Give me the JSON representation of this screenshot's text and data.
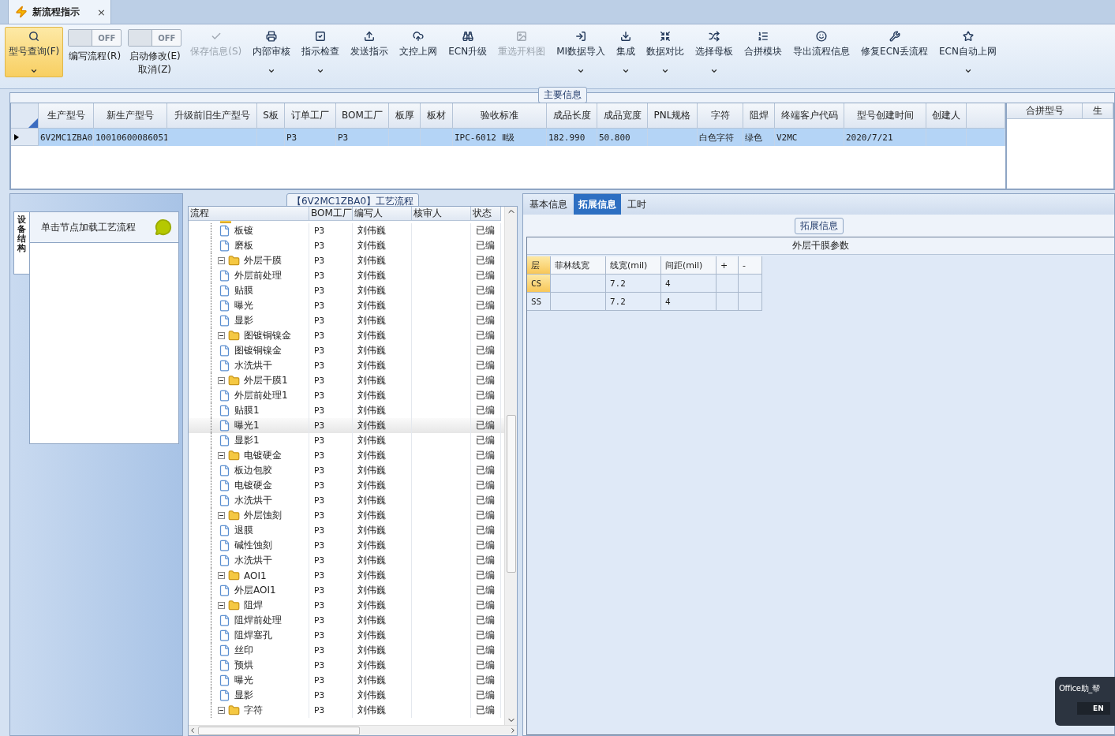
{
  "doc_tab": {
    "title": "新流程指示",
    "close": "×"
  },
  "ribbon": [
    {
      "kind": "button",
      "label": "型号查询(F)",
      "selected": true,
      "disabled": false,
      "dropdown": true
    },
    {
      "kind": "toggle",
      "label": "编写流程(R)",
      "switch": "OFF",
      "on": false
    },
    {
      "kind": "toggle",
      "label": "启动修改(E)",
      "sublabel": "取消(Z)",
      "switch": "OFF",
      "on": false
    },
    {
      "kind": "button",
      "label": "保存信息(S)",
      "selected": false,
      "disabled": true,
      "dropdown": false
    },
    {
      "kind": "button",
      "label": "内部审核",
      "selected": false,
      "disabled": false,
      "dropdown": true
    },
    {
      "kind": "button",
      "label": "指示检查",
      "selected": false,
      "disabled": false,
      "dropdown": true
    },
    {
      "kind": "button",
      "label": "发送指示",
      "selected": false,
      "disabled": false,
      "dropdown": false
    },
    {
      "kind": "button",
      "label": "文控上网",
      "selected": false,
      "disabled": false,
      "dropdown": false
    },
    {
      "kind": "button",
      "label": "ECN升级",
      "selected": false,
      "disabled": false,
      "dropdown": false
    },
    {
      "kind": "button",
      "label": "重选开料图",
      "selected": false,
      "disabled": true,
      "dropdown": false
    },
    {
      "kind": "button",
      "label": "MI数据导入",
      "selected": false,
      "disabled": false,
      "dropdown": true
    },
    {
      "kind": "button",
      "label": "集成",
      "selected": false,
      "disabled": false,
      "dropdown": true
    },
    {
      "kind": "button",
      "label": "数据对比",
      "selected": false,
      "disabled": false,
      "dropdown": true
    },
    {
      "kind": "button",
      "label": "选择母板",
      "selected": false,
      "disabled": false,
      "dropdown": true
    },
    {
      "kind": "button",
      "label": "合拼模块",
      "selected": false,
      "disabled": false,
      "dropdown": false
    },
    {
      "kind": "button",
      "label": "导出流程信息",
      "selected": false,
      "disabled": false,
      "dropdown": false
    },
    {
      "kind": "button",
      "label": "修复ECN丢流程",
      "selected": false,
      "disabled": false,
      "dropdown": false
    },
    {
      "kind": "button",
      "label": "ECN自动上网",
      "selected": false,
      "disabled": false,
      "dropdown": true
    }
  ],
  "main_info": {
    "title": "主要信息",
    "columns": [
      "生产型号",
      "新生产型号",
      "升级前旧生产型号",
      "S板",
      "订单工厂",
      "BOM工厂",
      "板厚",
      "板材",
      "验收标准",
      "成品长度",
      "成品宽度",
      "PNL规格",
      "字符",
      "阻焊",
      "终端客户代码",
      "型号创建时间",
      "创建人"
    ],
    "rows": [
      {
        "selected": true,
        "cells": [
          "6V2MC1ZBA0",
          "10010600086051",
          null,
          null,
          "P3",
          "P3",
          null,
          null,
          "IPC-6012 Ⅱ级",
          "182.990",
          "50.800",
          null,
          "白色字符",
          "绿色",
          "V2MC",
          "2020/7/21",
          null
        ]
      }
    ],
    "side_columns": [
      "合拼型号",
      "生"
    ]
  },
  "left_panel": {
    "vertical_tab": "设备结构",
    "hint": "单击节点加载工艺流程"
  },
  "process": {
    "title": "【6V2MC1ZBA0】工艺流程",
    "columns": [
      "流程",
      "BOM工厂",
      "编写人",
      "核审人",
      "状态"
    ],
    "tree": [
      {
        "kind": "folder",
        "children": [
          {
            "kind": "step",
            "label": "板镀",
            "bom": "P3",
            "writer": "刘伟巍",
            "status": "已编",
            "selected": false
          },
          {
            "kind": "step",
            "label": "磨板",
            "bom": "P3",
            "writer": "刘伟巍",
            "status": "已编",
            "selected": false
          }
        ]
      },
      {
        "kind": "folder",
        "label": "外层干膜",
        "bom": "P3",
        "writer": "刘伟巍",
        "status": "已编",
        "selected": false,
        "expanded": true,
        "children": [
          {
            "kind": "step",
            "label": "外层前处理",
            "bom": "P3",
            "writer": "刘伟巍",
            "status": "已编",
            "selected": false
          },
          {
            "kind": "step",
            "label": "贴膜",
            "bom": "P3",
            "writer": "刘伟巍",
            "status": "已编",
            "selected": false
          },
          {
            "kind": "step",
            "label": "曝光",
            "bom": "P3",
            "writer": "刘伟巍",
            "status": "已编",
            "selected": false
          },
          {
            "kind": "step",
            "label": "显影",
            "bom": "P3",
            "writer": "刘伟巍",
            "status": "已编",
            "selected": false
          }
        ]
      },
      {
        "kind": "folder",
        "label": "图镀铜镍金",
        "bom": "P3",
        "writer": "刘伟巍",
        "status": "已编",
        "selected": false,
        "expanded": true,
        "children": [
          {
            "kind": "step",
            "label": "图镀铜镍金",
            "bom": "P3",
            "writer": "刘伟巍",
            "status": "已编",
            "selected": false
          },
          {
            "kind": "step",
            "label": "水洗烘干",
            "bom": "P3",
            "writer": "刘伟巍",
            "status": "已编",
            "selected": false
          }
        ]
      },
      {
        "kind": "folder",
        "label": "外层干膜1",
        "bom": "P3",
        "writer": "刘伟巍",
        "status": "已编",
        "selected": false,
        "expanded": true,
        "children": [
          {
            "kind": "step",
            "label": "外层前处理1",
            "bom": "P3",
            "writer": "刘伟巍",
            "status": "已编",
            "selected": false
          },
          {
            "kind": "step",
            "label": "贴膜1",
            "bom": "P3",
            "writer": "刘伟巍",
            "status": "已编",
            "selected": false
          },
          {
            "kind": "step",
            "label": "曝光1",
            "bom": "P3",
            "writer": "刘伟巍",
            "status": "已编",
            "selected": true
          },
          {
            "kind": "step",
            "label": "显影1",
            "bom": "P3",
            "writer": "刘伟巍",
            "status": "已编",
            "selected": false
          }
        ]
      },
      {
        "kind": "folder",
        "label": "电镀硬金",
        "bom": "P3",
        "writer": "刘伟巍",
        "status": "已编",
        "selected": false,
        "expanded": true,
        "children": [
          {
            "kind": "step",
            "label": "板边包胶",
            "bom": "P3",
            "writer": "刘伟巍",
            "status": "已编",
            "selected": false
          },
          {
            "kind": "step",
            "label": "电镀硬金",
            "bom": "P3",
            "writer": "刘伟巍",
            "status": "已编",
            "selected": false
          },
          {
            "kind": "step",
            "label": "水洗烘干",
            "bom": "P3",
            "writer": "刘伟巍",
            "status": "已编",
            "selected": false
          }
        ]
      },
      {
        "kind": "folder",
        "label": "外层蚀刻",
        "bom": "P3",
        "writer": "刘伟巍",
        "status": "已编",
        "selected": false,
        "expanded": true,
        "children": [
          {
            "kind": "step",
            "label": "退膜",
            "bom": "P3",
            "writer": "刘伟巍",
            "status": "已编",
            "selected": false
          },
          {
            "kind": "step",
            "label": "碱性蚀刻",
            "bom": "P3",
            "writer": "刘伟巍",
            "status": "已编",
            "selected": false
          },
          {
            "kind": "step",
            "label": "水洗烘干",
            "bom": "P3",
            "writer": "刘伟巍",
            "status": "已编",
            "selected": false
          }
        ]
      },
      {
        "kind": "folder",
        "label": "AOI1",
        "bom": "P3",
        "writer": "刘伟巍",
        "status": "已编",
        "selected": false,
        "expanded": true,
        "children": [
          {
            "kind": "step",
            "label": "外层AOI1",
            "bom": "P3",
            "writer": "刘伟巍",
            "status": "已编",
            "selected": false
          }
        ]
      },
      {
        "kind": "folder",
        "label": "阻焊",
        "bom": "P3",
        "writer": "刘伟巍",
        "status": "已编",
        "selected": false,
        "expanded": true,
        "children": [
          {
            "kind": "step",
            "label": "阻焊前处理",
            "bom": "P3",
            "writer": "刘伟巍",
            "status": "已编",
            "selected": false
          },
          {
            "kind": "step",
            "label": "阻焊塞孔",
            "bom": "P3",
            "writer": "刘伟巍",
            "status": "已编",
            "selected": false
          },
          {
            "kind": "step",
            "label": "丝印",
            "bom": "P3",
            "writer": "刘伟巍",
            "status": "已编",
            "selected": false
          },
          {
            "kind": "step",
            "label": "预烘",
            "bom": "P3",
            "writer": "刘伟巍",
            "status": "已编",
            "selected": false
          },
          {
            "kind": "step",
            "label": "曝光",
            "bom": "P3",
            "writer": "刘伟巍",
            "status": "已编",
            "selected": false
          },
          {
            "kind": "step",
            "label": "显影",
            "bom": "P3",
            "writer": "刘伟巍",
            "status": "已编",
            "selected": false
          }
        ]
      },
      {
        "kind": "folder",
        "label": "字符",
        "bom": "P3",
        "writer": "刘伟巍",
        "status": "已编",
        "selected": false,
        "expanded": true
      }
    ]
  },
  "detail": {
    "tabs": [
      {
        "label": "基本信息",
        "selected": false
      },
      {
        "label": "拓展信息",
        "selected": true
      },
      {
        "label": "工时",
        "selected": false
      }
    ],
    "group_title": "拓展信息",
    "table_title": "外层干膜参数",
    "columns": [
      "层",
      "菲林线宽",
      "线宽(mil)",
      "间距(mil)",
      "+",
      "-"
    ],
    "rows": [
      {
        "selected": true,
        "cells": [
          "CS",
          null,
          "7.2",
          "4",
          null,
          null
        ]
      },
      {
        "selected": false,
        "cells": [
          "SS",
          null,
          "7.2",
          "4",
          null,
          null
        ]
      }
    ]
  },
  "assistant": {
    "title": "Office助_帮",
    "key": "EN"
  }
}
